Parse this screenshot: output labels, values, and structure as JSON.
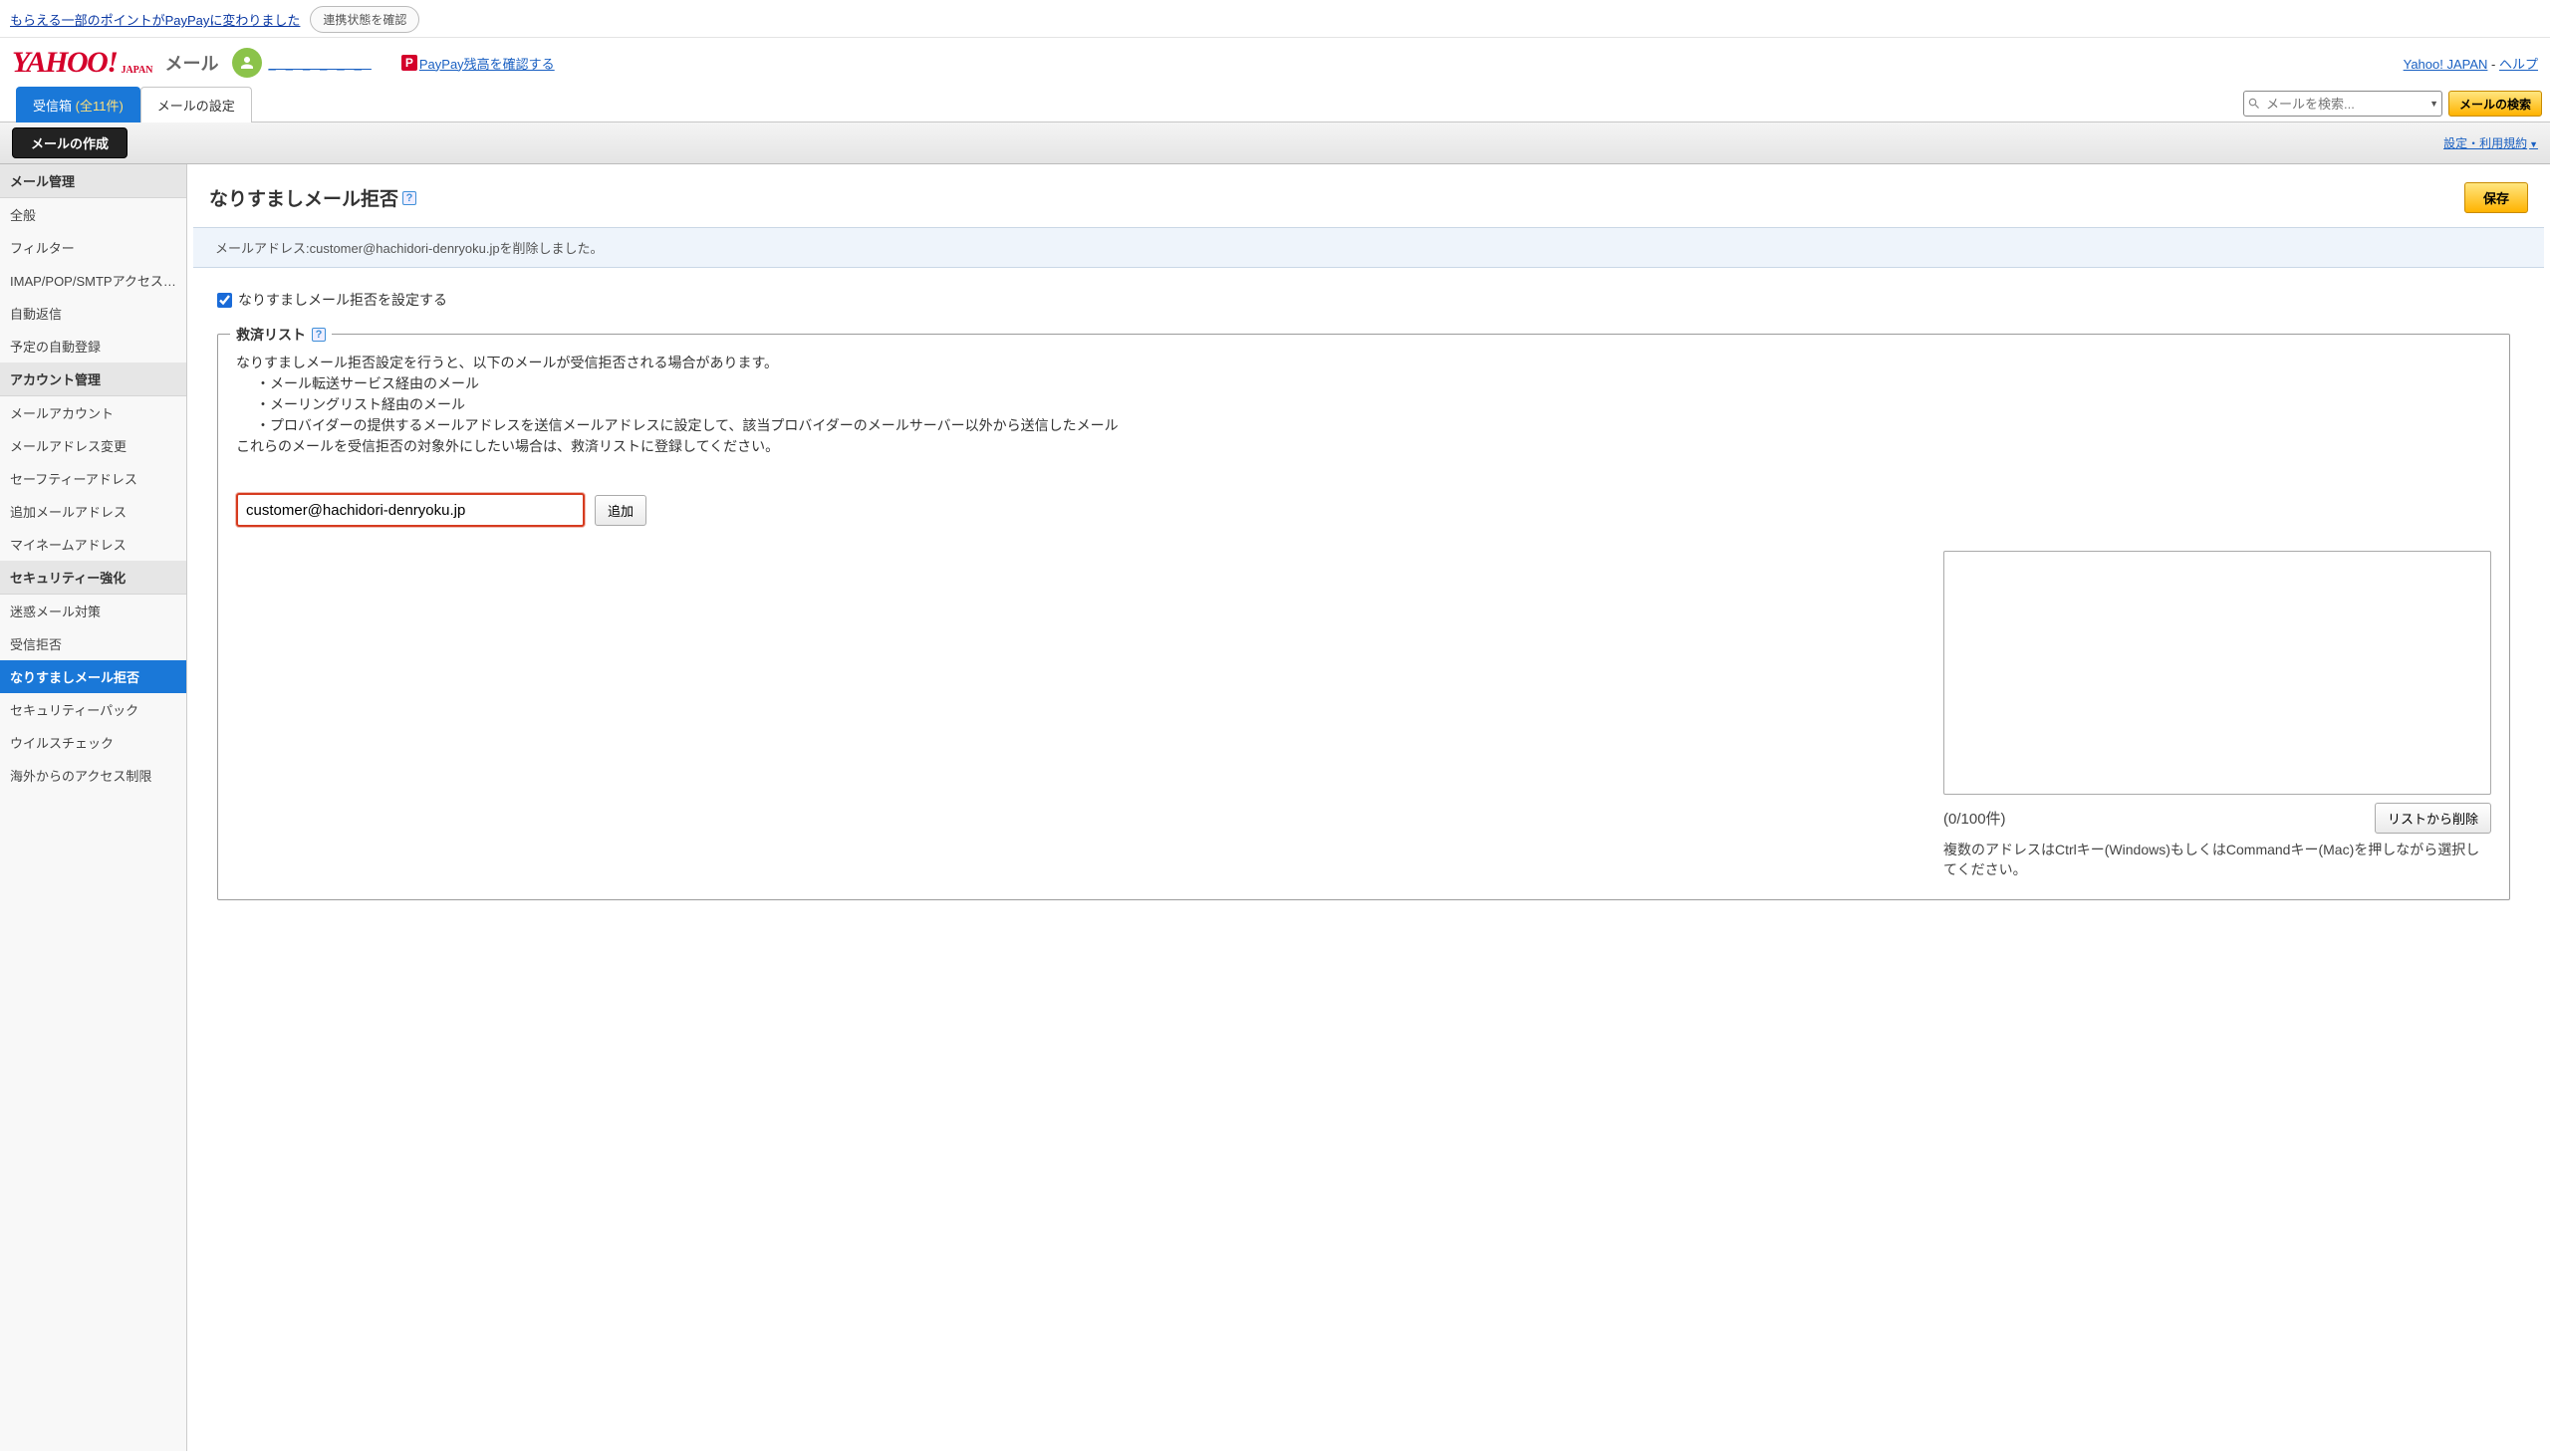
{
  "notice": {
    "text": "もらえる一部のポイントがPayPayに変わりました",
    "button": "連携状態を確認"
  },
  "header": {
    "logo_text": "YAHOO!",
    "logo_sub": "JAPAN",
    "product": "メール",
    "paypay_link": "PayPay残高を確認する",
    "link_yahoo": "Yahoo! JAPAN",
    "link_help": "ヘルプ",
    "sep": " - "
  },
  "tabs": {
    "inbox_label": "受信箱",
    "inbox_count": " (全11件)",
    "settings_label": "メールの設定"
  },
  "search": {
    "placeholder": "メールを検索...",
    "button": "メールの検索"
  },
  "toolbar": {
    "compose": "メールの作成",
    "settings_link": "設定・利用規約"
  },
  "sidebar": {
    "group1_title": "メール管理",
    "group1": [
      "全般",
      "フィルター",
      "IMAP/POP/SMTPアクセス…",
      "自動返信",
      "予定の自動登録"
    ],
    "group2_title": "アカウント管理",
    "group2": [
      "メールアカウント",
      "メールアドレス変更",
      "セーフティーアドレス",
      "追加メールアドレス",
      "マイネームアドレス"
    ],
    "group3_title": "セキュリティー強化",
    "group3": [
      "迷惑メール対策",
      "受信拒否",
      "なりすましメール拒否",
      "セキュリティーパック",
      "ウイルスチェック",
      "海外からのアクセス制限"
    ]
  },
  "main": {
    "title": "なりすましメール拒否",
    "save": "保存",
    "info": "メールアドレス:customer@hachidori-denryoku.jpを削除しました。",
    "checkbox_label": "なりすましメール拒否を設定する",
    "fieldset_title": "救済リスト",
    "desc_intro": "なりすましメール拒否設定を行うと、以下のメールが受信拒否される場合があります。",
    "desc_b1": "・メール転送サービス経由のメール",
    "desc_b2": "・メーリングリスト経由のメール",
    "desc_b3": "・プロバイダーの提供するメールアドレスを送信メールアドレスに設定して、該当プロバイダーのメールサーバー以外から送信したメール",
    "desc_outro": "これらのメールを受信拒否の対象外にしたい場合は、救済リストに登録してください。",
    "email_value": "customer@hachidori-denryoku.jp",
    "add_btn": "追加",
    "count_label": "(0/100件)",
    "remove_btn": "リストから削除",
    "hint": "複数のアドレスはCtrlキー(Windows)もしくはCommandキー(Mac)を押しながら選択してください。"
  }
}
